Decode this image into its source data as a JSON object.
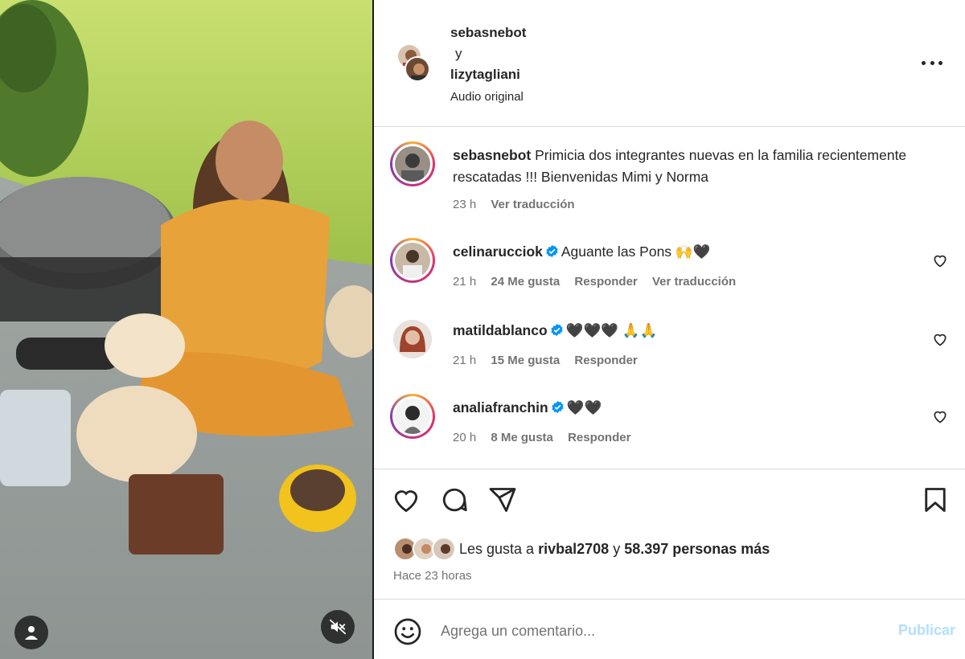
{
  "post": {
    "authors": [
      "sebasnebot",
      "lizytagliani"
    ],
    "and_word": "y",
    "audio": "Audio original",
    "caption": {
      "username": "sebasnebot",
      "text": "Primicia dos integrantes nuevas en la familia recientemente rescatadas !!! Bienvenidas Mimi y Norma",
      "time": "23 h",
      "translate": "Ver traducción"
    }
  },
  "comments": [
    {
      "username": "celinarucciok",
      "text": "Aguante las Pons 🙌🖤",
      "time": "21 h",
      "likes": "24 Me gusta",
      "reply": "Responder",
      "translate": "Ver traducción"
    },
    {
      "username": "matildablanco",
      "text": "🖤🖤🖤 🙏🙏",
      "time": "21 h",
      "likes": "15 Me gusta",
      "reply": "Responder"
    },
    {
      "username": "analiafranchin",
      "text": "🖤🖤",
      "time": "20 h",
      "likes": "8 Me gusta",
      "reply": "Responder"
    }
  ],
  "likes": {
    "prefix": "Les gusta a",
    "user": "rivbal2708",
    "joiner": "y",
    "others": "58.397 personas más"
  },
  "time_ago": "Hace 23 horas",
  "comment_input": {
    "placeholder": "Agrega un comentario..."
  },
  "publish_label": "Publicar",
  "icons": [
    "person-tag-icon",
    "muted-speaker-icon",
    "more-options-icon",
    "heart-icon",
    "comment-icon",
    "share-icon",
    "bookmark-icon",
    "emoji-icon",
    "verified-badge-icon"
  ],
  "colors": {
    "verified": "#0095f6",
    "publish_disabled": "#b2dffc",
    "secondary_text": "#737373"
  }
}
